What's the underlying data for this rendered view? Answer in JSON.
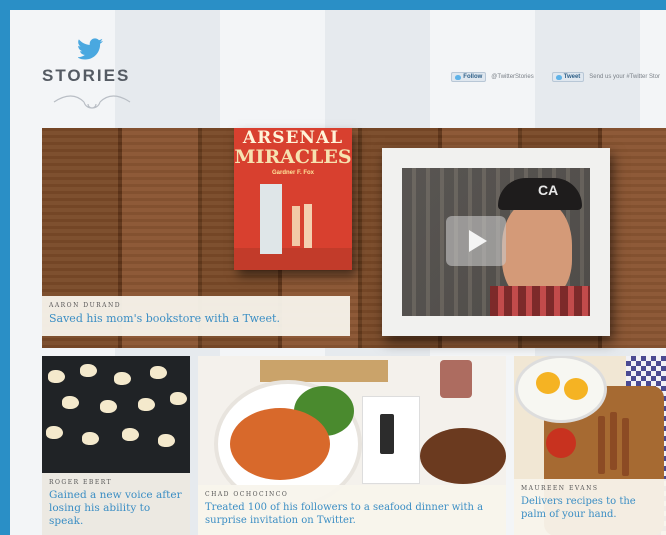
{
  "brand": {
    "title": "STORIES"
  },
  "header": {
    "follow_label": "Follow",
    "follow_handle": "@TwitterStories",
    "tweet_label": "Tweet",
    "tweet_text": "Send us your #Twitter Stor"
  },
  "hero": {
    "book_title_1": "ARSENAL",
    "book_title_2": "MIRACLES",
    "book_author": "Gardner F. Fox",
    "story_name": "Aaron Durand",
    "story_text": "Saved his mom's bookstore with a Tweet.",
    "video_cap_letters": "CA"
  },
  "tiles": [
    {
      "name": "Roger Ebert",
      "text": "Gained a new voice after losing his ability to speak."
    },
    {
      "name": "Chad Ochocinco",
      "text": "Treated 100 of his followers to a seafood dinner with a surprise invitation on Twitter."
    },
    {
      "name": "Maureen Evans",
      "text": "Delivers recipes to the palm of your hand."
    }
  ],
  "colors": {
    "accent": "#3b8ec4",
    "border": "#2a8fc6",
    "twitter": "#5fb3e8"
  },
  "icons": {
    "logo": "twitter-bird-icon",
    "play": "play-icon"
  }
}
